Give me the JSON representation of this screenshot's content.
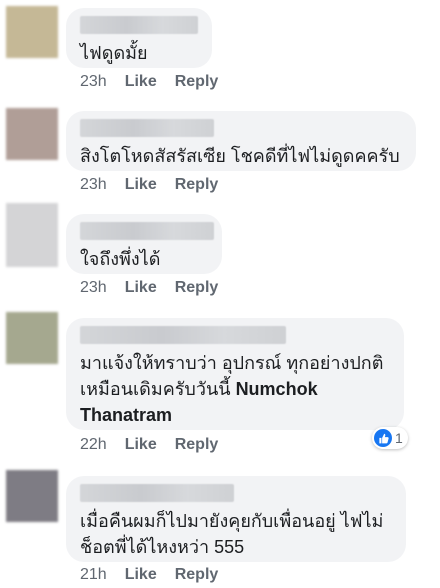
{
  "comments": [
    {
      "text": "ไฟดูดมั้ย",
      "time": "23h",
      "like_label": "Like",
      "reply_label": "Reply",
      "avatar_color": "#c5b896"
    },
    {
      "text": "สิงโตโหดสัสรัสเซีย โชคดีที่ไฟไม่ดูดคครับ",
      "time": "23h",
      "like_label": "Like",
      "reply_label": "Reply",
      "avatar_color": "#b09e97"
    },
    {
      "text": "ใจถึงพึ่งได้",
      "time": "23h",
      "like_label": "Like",
      "reply_label": "Reply",
      "avatar_color": "#d4d4d6"
    },
    {
      "text_pre": "มาแจ้งให้ทราบว่า อุปกรณ์ ทุกอย่างปกติ\nเหมือนเดิมครับวันนี้ ",
      "text_link": "Numchok\nThanatram",
      "time": "22h",
      "like_label": "Like",
      "reply_label": "Reply",
      "reaction_count": "1",
      "avatar_color": "#a5a88f"
    },
    {
      "text": "เมื่อคืนผมก็ไปมายังคุยกับเพื่อนอยู่ ไฟไม่\nช็อตพี่ได้ไหงหว่า 555",
      "time": "21h",
      "like_label": "Like",
      "reply_label": "Reply",
      "avatar_color": "#7e7c84"
    }
  ]
}
